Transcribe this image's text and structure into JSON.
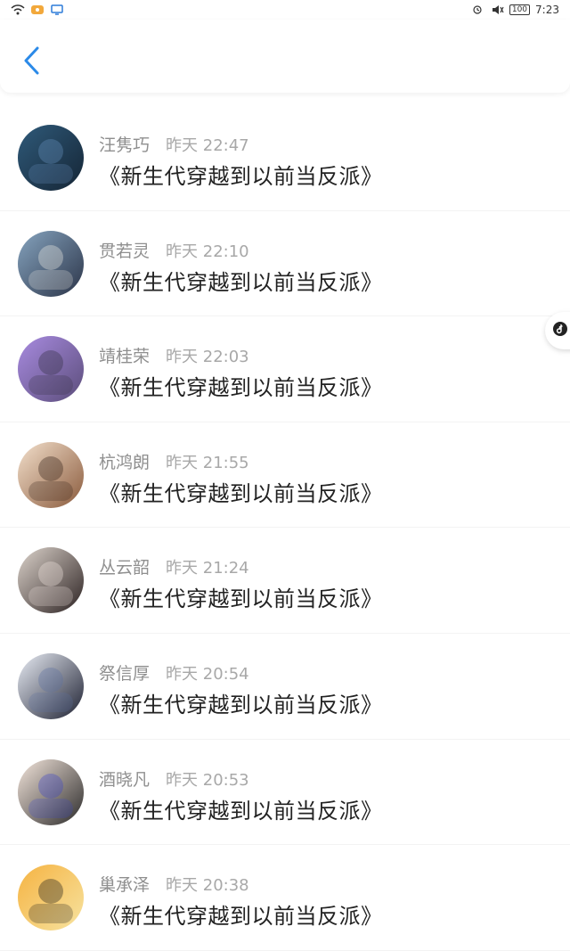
{
  "status_bar": {
    "time": "7:23",
    "battery": "100"
  },
  "header": {
    "back_label": "<"
  },
  "list": {
    "items": [
      {
        "name": "汪隽巧",
        "time": "昨天 22:47",
        "title": "《新生代穿越到以前当反派》",
        "avatar_colors": [
          "#2f5a7a",
          "#152535",
          "#6b95c2"
        ]
      },
      {
        "name": "贯若灵",
        "time": "昨天 22:10",
        "title": "《新生代穿越到以前当反派》",
        "avatar_colors": [
          "#86a4bf",
          "#2b3448",
          "#f4f0e8"
        ]
      },
      {
        "name": "靖桂荣",
        "time": "昨天 22:03",
        "title": "《新生代穿越到以前当反派》",
        "avatar_colors": [
          "#a88be0",
          "#5b4d7a",
          "#2f2a3d"
        ]
      },
      {
        "name": "杭鸿朗",
        "time": "昨天 21:55",
        "title": "《新生代穿越到以前当反派》",
        "avatar_colors": [
          "#f3e0cc",
          "#8a5a3c",
          "#2a1a12"
        ]
      },
      {
        "name": "丛云韶",
        "time": "昨天 21:24",
        "title": "《新生代穿越到以前当反派》",
        "avatar_colors": [
          "#ddd4cc",
          "#2c2222",
          "#f4e9e3"
        ]
      },
      {
        "name": "祭信厚",
        "time": "昨天 20:54",
        "title": "《新生代穿越到以前当反派》",
        "avatar_colors": [
          "#e9edf5",
          "#1e2132",
          "#5d6fa0"
        ]
      },
      {
        "name": "酒晓凡",
        "time": "昨天 20:53",
        "title": "《新生代穿越到以前当反派》",
        "avatar_colors": [
          "#f4e6dc",
          "#2b2a2a",
          "#3c46c9"
        ]
      },
      {
        "name": "巢承泽",
        "time": "昨天 20:38",
        "title": "《新生代穿越到以前当反派》",
        "avatar_colors": [
          "#f5b342",
          "#f7e3a0",
          "#151515"
        ]
      }
    ]
  }
}
